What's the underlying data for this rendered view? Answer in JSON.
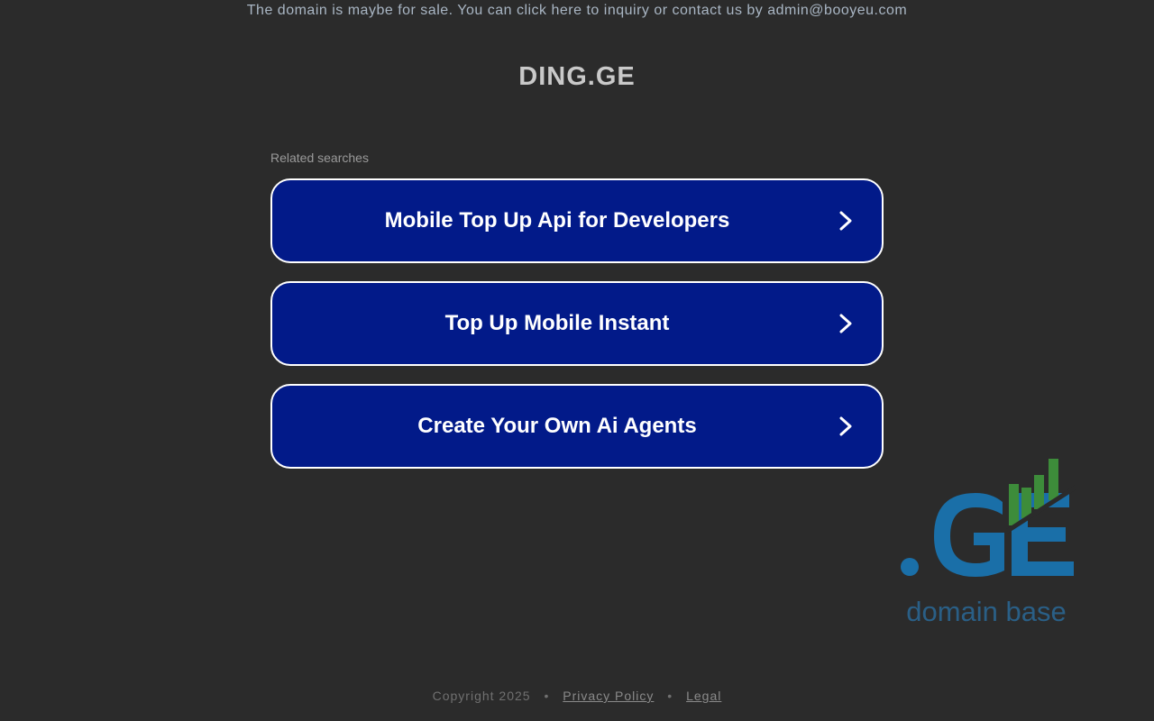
{
  "banner": {
    "text": "The domain is maybe for sale. You can click here to inquiry or contact us by admin@booyeu.com"
  },
  "title": "DING.GE",
  "related": {
    "label": "Related searches",
    "items": [
      {
        "label": "Mobile Top Up Api for Developers"
      },
      {
        "label": "Top Up Mobile Instant"
      },
      {
        "label": "Create Your Own Ai Agents"
      }
    ]
  },
  "logo": {
    "text": ".GE",
    "subtitle": "domain base",
    "colors": {
      "blue": "#1a6fa8",
      "green": "#3d8c3a",
      "subtitle": "#2a5f86"
    }
  },
  "footer": {
    "copyright": "Copyright 2025",
    "separator": "•",
    "privacy": "Privacy Policy",
    "legal": "Legal"
  },
  "colors": {
    "background": "#2b2b2b",
    "button": "#021a89",
    "button_border": "#ffffff"
  }
}
